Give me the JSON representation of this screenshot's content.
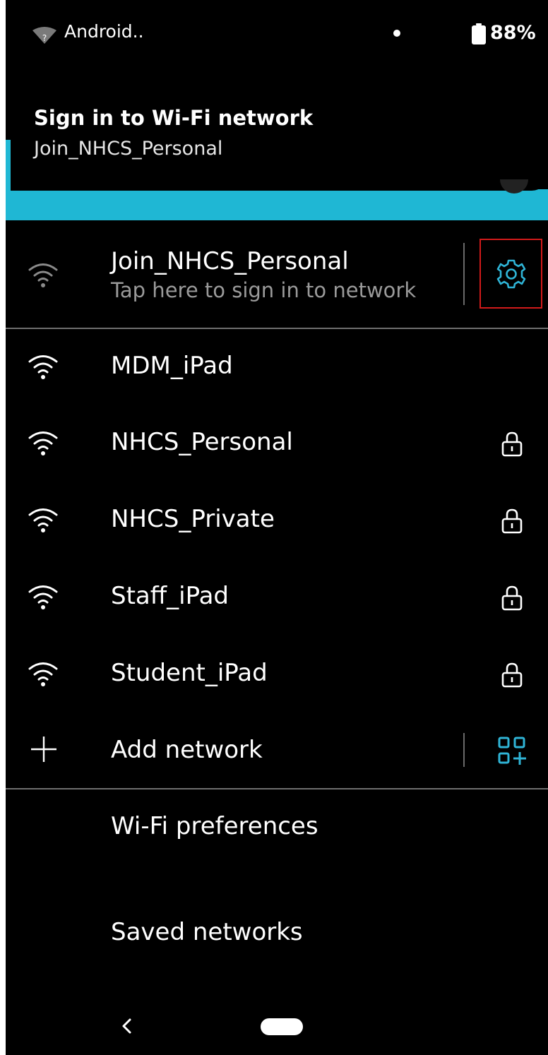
{
  "status_bar": {
    "carrier": "Android..",
    "battery_percent": "88%",
    "wifi_icon": "wifi-question-icon"
  },
  "notification": {
    "title": "Sign in to Wi-Fi network",
    "network": "Join_NHCS_Personal",
    "accent_color": "#1fb7d4"
  },
  "connected": {
    "name": "Join_NHCS_Personal",
    "status": "Tap here to sign in to network",
    "settings_icon": "gear-icon",
    "highlight_color": "#d11a1a"
  },
  "networks": [
    {
      "name": "MDM_iPad",
      "secured": false
    },
    {
      "name": "NHCS_Personal",
      "secured": true
    },
    {
      "name": "NHCS_Private",
      "secured": true
    },
    {
      "name": "Staff_iPad",
      "secured": true
    },
    {
      "name": "Student_iPad",
      "secured": true
    }
  ],
  "add_network": {
    "label": "Add network",
    "qr_icon": "qr-scan-icon"
  },
  "menu": {
    "wifi_preferences": "Wi-Fi preferences",
    "saved_networks": "Saved networks"
  },
  "nav_bar": {
    "back_icon": "back-chevron-icon",
    "home_icon": "home-pill-icon"
  }
}
